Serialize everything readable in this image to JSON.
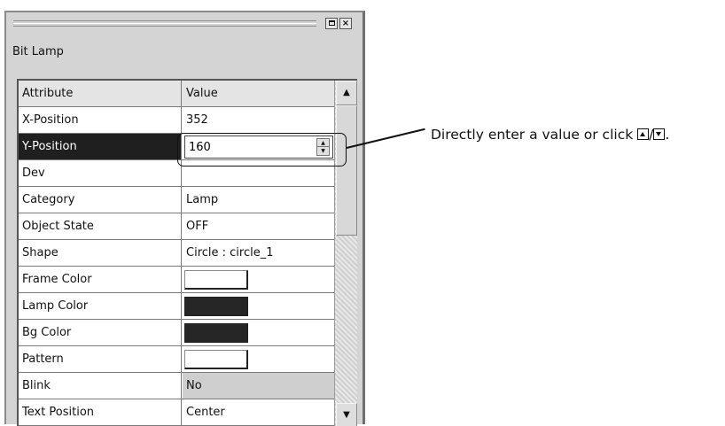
{
  "panel": {
    "title": "Bit Lamp",
    "restore_glyph": "restore-icon",
    "close_label": "×"
  },
  "grid": {
    "header": {
      "attribute": "Attribute",
      "value": "Value"
    },
    "rows": [
      {
        "attribute": "X-Position",
        "value": "352"
      },
      {
        "attribute": "Y-Position",
        "value": "160"
      },
      {
        "attribute": "Dev",
        "value": ""
      },
      {
        "attribute": "Category",
        "value": "Lamp"
      },
      {
        "attribute": "Object State",
        "value": "OFF"
      },
      {
        "attribute": "Shape",
        "value": "Circle : circle_1"
      },
      {
        "attribute": "Frame Color",
        "value": "",
        "swatch": "#ffffff"
      },
      {
        "attribute": "Lamp Color",
        "value": "",
        "swatch": "#262626"
      },
      {
        "attribute": "Bg Color",
        "value": "",
        "swatch": "#262626"
      },
      {
        "attribute": "Pattern",
        "value": "",
        "swatch": "#ffffff"
      },
      {
        "attribute": "Blink",
        "value": "No"
      },
      {
        "attribute": "Text Position",
        "value": "Center"
      }
    ]
  },
  "annotation": {
    "text_before": "Directly enter a value or click ",
    "separator": "/",
    "text_after": "."
  }
}
